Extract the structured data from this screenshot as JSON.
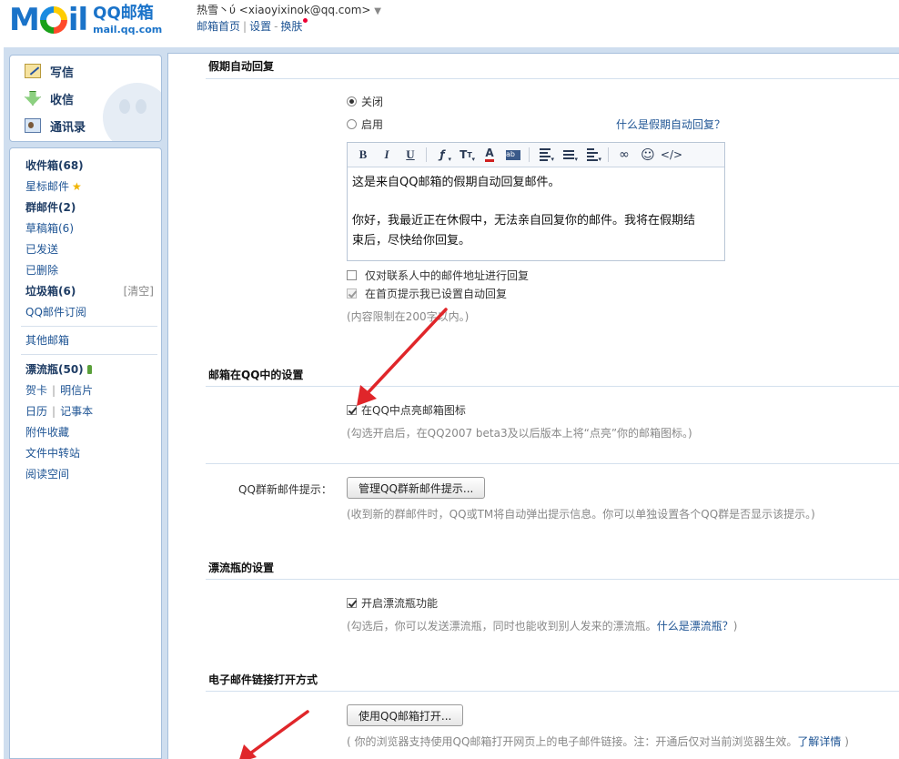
{
  "header": {
    "logo_mail": "M",
    "logo_il": "il",
    "logo_title": "QQ邮箱",
    "logo_url": "mail.qq.com",
    "user_name": "热雪丶ύ",
    "user_email": "<xiaoyixinok@qq.com>",
    "links": [
      "邮箱首页",
      "设置",
      "换肤"
    ]
  },
  "sidebar": {
    "actions": [
      {
        "label": "写信",
        "icon": "write-icon"
      },
      {
        "label": "收信",
        "icon": "inbox-icon"
      },
      {
        "label": "通讯录",
        "icon": "contacts-icon"
      }
    ],
    "inbox": "收件箱(68)",
    "starred": "星标邮件",
    "group": "群邮件(2)",
    "drafts": "草稿箱(6)",
    "sent": "已发送",
    "deleted": "已删除",
    "spam": "垃圾箱(6)",
    "spam_clear": "[清空]",
    "subscriptions": "QQ邮件订阅",
    "other_mailbox": "其他邮箱",
    "drift_bottle": "漂流瓶(50)",
    "cards": "贺卡",
    "postcards": "明信片",
    "calendar": "日历",
    "notebook": "记事本",
    "attachments": "附件收藏",
    "transfer": "文件中转站",
    "reading": "阅读空间"
  },
  "vacation": {
    "title": "假期自动回复",
    "off_label": "关闭",
    "on_label": "启用",
    "help_link": "什么是假期自动回复？",
    "body_line1": "这是来自QQ邮箱的假期自动回复邮件。",
    "body_line2": "你好，我最近正在休假中，无法亲自回复你的邮件。我将在假期结",
    "body_line3": "束后，尽快给你回复。",
    "contacts_only": "仅对联系人中的邮件地址进行回复",
    "homepage_notice": "在首页提示我已设置自动回复",
    "limit_hint": "(内容限制在200字以内。)"
  },
  "qq_settings": {
    "title": "邮箱在QQ中的设置",
    "light_icon": "在QQ中点亮邮箱图标",
    "light_hint": "(勾选开启后，在QQ2007 beta3及以后版本上将“点亮”你的邮箱图标。)",
    "group_label": "QQ群新邮件提示：",
    "group_button": "管理QQ群新邮件提示...",
    "group_hint": "(收到新的群邮件时，QQ或TM将自动弹出提示信息。你可以单独设置各个QQ群是否显示该提示。)"
  },
  "bottle": {
    "title": "漂流瓶的设置",
    "enable": "开启漂流瓶功能",
    "hint_prefix": "(勾选后，你可以发送漂流瓶，同时也能收到别人发来的漂流瓶。",
    "hint_link": "什么是漂流瓶？",
    "hint_suffix": ")"
  },
  "email_link": {
    "title": "电子邮件链接打开方式",
    "button": "使用QQ邮箱打开...",
    "hint_prefix": "( 你的浏览器支持使用QQ邮箱打开网页上的电子邮件链接。注：开通后仅对当前浏览器生效。",
    "hint_link": "了解详情",
    "hint_suffix": " )"
  },
  "colors": {
    "accent": "#1e5494",
    "frame": "#cfdeef",
    "arrow": "#e0262a"
  }
}
